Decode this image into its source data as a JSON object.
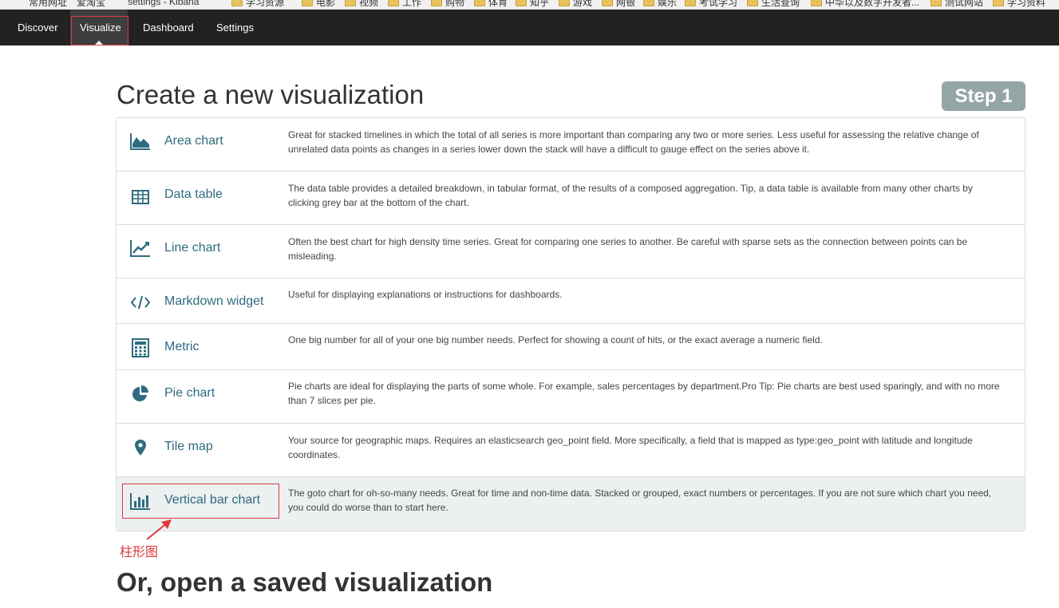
{
  "bookmarks": [
    "常用网址",
    "爱淘宝",
    "settings - Kibana",
    "学习资源",
    "电影",
    "视频",
    "工作",
    "购物",
    "体育",
    "知乎",
    "游戏",
    "网银",
    "娱乐",
    "考试学习",
    "生活查询",
    "中华以及数字开发者...",
    "测试网站",
    "学习资料"
  ],
  "nav": {
    "discover": "Discover",
    "visualize": "Visualize",
    "dashboard": "Dashboard",
    "settings": "Settings"
  },
  "header": {
    "title": "Create a new visualization",
    "step": "Step 1"
  },
  "visualizations": [
    {
      "icon": "area-chart-icon",
      "label": "Area chart",
      "desc": "Great for stacked timelines in which the total of all series is more important than comparing any two or more series. Less useful for assessing the relative change of unrelated data points as changes in a series lower down the stack will have a difficult to gauge effect on the series above it."
    },
    {
      "icon": "table-icon",
      "label": "Data table",
      "desc": "The data table provides a detailed breakdown, in tabular format, of the results of a composed aggregation. Tip, a data table is available from many other charts by clicking grey bar at the bottom of the chart."
    },
    {
      "icon": "line-chart-icon",
      "label": "Line chart",
      "desc": "Often the best chart for high density time series. Great for comparing one series to another. Be careful with sparse sets as the connection between points can be misleading."
    },
    {
      "icon": "code-icon",
      "label": "Markdown widget",
      "desc": "Useful for displaying explanations or instructions for dashboards."
    },
    {
      "icon": "calculator-icon",
      "label": "Metric",
      "desc": "One big number for all of your one big number needs. Perfect for showing a count of hits, or the exact average a numeric field."
    },
    {
      "icon": "pie-chart-icon",
      "label": "Pie chart",
      "desc": "Pie charts are ideal for displaying the parts of some whole. For example, sales percentages by department.Pro Tip: Pie charts are best used sparingly, and with no more than 7 slices per pie."
    },
    {
      "icon": "map-marker-icon",
      "label": "Tile map",
      "desc": "Your source for geographic maps. Requires an elasticsearch geo_point field. More specifically, a field that is mapped as type:geo_point with latitude and longitude coordinates."
    },
    {
      "icon": "bar-chart-icon",
      "label": "Vertical bar chart",
      "desc": "The goto chart for oh-so-many needs. Great for time and non-time data. Stacked or grouped, exact numbers or percentages. If you are not sure which chart you need, you could do worse than to start here."
    }
  ],
  "annotation": "柱形图",
  "saved": {
    "title": "Or, open a saved visualization"
  },
  "colors": {
    "navbar": "#222222",
    "accent": "#2f6b7f",
    "step_badge": "#95a5a6",
    "annotation_red": "#e0393e"
  }
}
